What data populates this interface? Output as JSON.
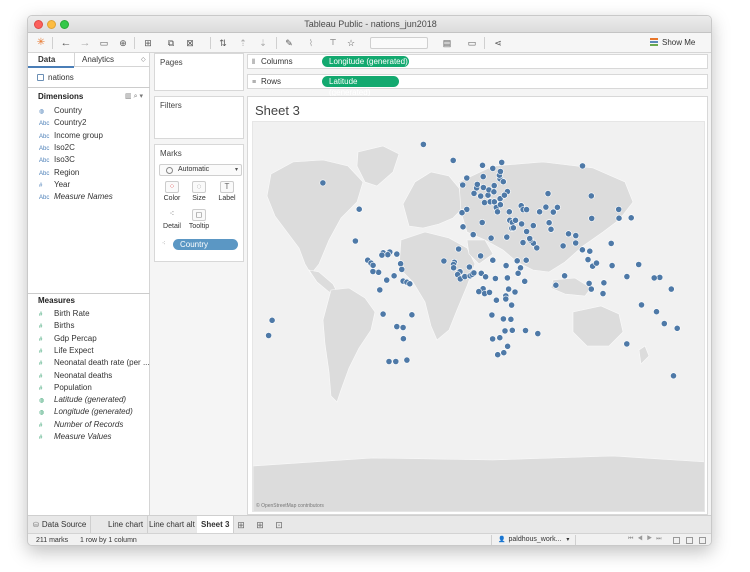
{
  "window": {
    "title": "Tableau Public - nations_jun2018"
  },
  "toolbar": {
    "show_me": "Show Me"
  },
  "data_pane": {
    "tabs": [
      "Data",
      "Analytics"
    ],
    "source": "nations",
    "dimensions_label": "Dimensions",
    "dimensions": [
      {
        "icon": "globe-icon",
        "label": "Country"
      },
      {
        "icon": "abc-icon",
        "label": "Country2"
      },
      {
        "icon": "abc-icon",
        "label": "Income group"
      },
      {
        "icon": "abc-icon",
        "label": "Iso2C"
      },
      {
        "icon": "abc-icon",
        "label": "Iso3C"
      },
      {
        "icon": "abc-icon",
        "label": "Region"
      },
      {
        "icon": "number-icon",
        "label": "Year"
      },
      {
        "icon": "abc-icon",
        "label": "Measure Names"
      }
    ],
    "measures_label": "Measures",
    "measures": [
      {
        "icon": "number-icon",
        "label": "Birth Rate"
      },
      {
        "icon": "number-icon",
        "label": "Births"
      },
      {
        "icon": "number-icon",
        "label": "Gdp Percap"
      },
      {
        "icon": "number-icon",
        "label": "Life Expect"
      },
      {
        "icon": "number-icon",
        "label": "Neonatal death rate (per ..."
      },
      {
        "icon": "number-icon",
        "label": "Neonatal deaths"
      },
      {
        "icon": "number-icon",
        "label": "Population"
      },
      {
        "icon": "globe-icon",
        "label": "Latitude (generated)"
      },
      {
        "icon": "globe-icon",
        "label": "Longitude (generated)"
      },
      {
        "icon": "number-icon",
        "label": "Number of Records"
      },
      {
        "icon": "number-icon",
        "label": "Measure Values"
      }
    ]
  },
  "cards": {
    "pages": "Pages",
    "filters": "Filters",
    "marks": "Marks",
    "mark_type": "Automatic",
    "mark_buttons": [
      "Color",
      "Size",
      "Label",
      "Detail",
      "Tooltip"
    ],
    "detail_pill": "Country"
  },
  "shelves": {
    "columns_label": "Columns",
    "columns_pill": "Longitude (generated)",
    "rows_label": "Rows",
    "rows_pill": "Latitude (generated)"
  },
  "view": {
    "sheet_title": "Sheet 3",
    "attribution": "© OpenStreetMap contributors",
    "mark_color": "#4e79a7",
    "points": [
      [
        -41.3,
        72.0
      ],
      [
        -128.2,
        53.2
      ],
      [
        -96.8,
        40.4
      ],
      [
        -100.1,
        24.9
      ],
      [
        -89.5,
        15.5
      ],
      [
        -86.6,
        14.1
      ],
      [
        -84.8,
        13.0
      ],
      [
        -80.1,
        9.6
      ],
      [
        -85.0,
        10.0
      ],
      [
        -76.1,
        19.1
      ],
      [
        -70.4,
        19.5
      ],
      [
        -64.3,
        18.5
      ],
      [
        -61.0,
        13.8
      ],
      [
        -60.0,
        11.0
      ],
      [
        -72.1,
        18.2
      ],
      [
        -77.2,
        18.0
      ],
      [
        -66.7,
        7.9
      ],
      [
        -73.1,
        5.8
      ],
      [
        -58.9,
        5.3
      ],
      [
        -55.6,
        4.8
      ],
      [
        -53.1,
        4.0
      ],
      [
        -79.0,
        1.0
      ],
      [
        -76.2,
        -10.8
      ],
      [
        -64.3,
        -16.9
      ],
      [
        -51.3,
        -11.1
      ],
      [
        -58.6,
        -22.8
      ],
      [
        -71.1,
        -33.9
      ],
      [
        -65.2,
        -33.9
      ],
      [
        -55.6,
        -33.2
      ],
      [
        -58.9,
        -17.3
      ],
      [
        -3.8,
        55.6
      ],
      [
        -7.4,
        52.2
      ],
      [
        -15.6,
        64.2
      ],
      [
        9.8,
        61.8
      ],
      [
        18.7,
        60.3
      ],
      [
        26.4,
        63.2
      ],
      [
        10.4,
        56.3
      ],
      [
        2.4,
        48.1
      ],
      [
        -3.8,
        40.3
      ],
      [
        -8.0,
        38.7
      ],
      [
        11.5,
        43.6
      ],
      [
        14.5,
        47.2
      ],
      [
        8.2,
        46.8
      ],
      [
        10.5,
        51.0
      ],
      [
        4.7,
        50.8
      ],
      [
        5.3,
        52.5
      ],
      [
        19.9,
        51.9
      ],
      [
        15.3,
        49.8
      ],
      [
        19.6,
        48.9
      ],
      [
        25.0,
        45.5
      ],
      [
        16.4,
        44.0
      ],
      [
        20.0,
        44.0
      ],
      [
        21.7,
        41.2
      ],
      [
        22.7,
        39.1
      ],
      [
        25.2,
        42.6
      ],
      [
        24.9,
        55.2
      ],
      [
        24.4,
        57.0
      ],
      [
        25.2,
        58.8
      ],
      [
        27.7,
        53.8
      ],
      [
        31.3,
        49.0
      ],
      [
        28.7,
        47.2
      ],
      [
        32.9,
        39.1
      ],
      [
        33.4,
        35.0
      ],
      [
        43.2,
        42.1
      ],
      [
        44.9,
        40.2
      ],
      [
        47.9,
        40.2
      ],
      [
        35.5,
        33.9
      ],
      [
        38.3,
        35.0
      ],
      [
        35.2,
        31.1
      ],
      [
        36.5,
        31.3
      ],
      [
        43.6,
        33.2
      ],
      [
        53.7,
        32.4
      ],
      [
        44.8,
        24.1
      ],
      [
        53.8,
        23.8
      ],
      [
        56.7,
        21.5
      ],
      [
        47.5,
        15.5
      ],
      [
        51.1,
        25.4
      ],
      [
        50.6,
        26.1
      ],
      [
        47.9,
        29.5
      ],
      [
        69.0,
        30.6
      ],
      [
        67.3,
        33.8
      ],
      [
        66.4,
        48.0
      ],
      [
        64.6,
        41.4
      ],
      [
        59.1,
        39.1
      ],
      [
        71.0,
        39.0
      ],
      [
        74.5,
        41.3
      ],
      [
        79.4,
        22.5
      ],
      [
        84.1,
        28.4
      ],
      [
        90.4,
        27.5
      ],
      [
        90.3,
        23.9
      ],
      [
        80.7,
        7.9
      ],
      [
        73.2,
        3.3
      ],
      [
        96.1,
        20.6
      ],
      [
        101.0,
        15.8
      ],
      [
        104.9,
        12.6
      ],
      [
        102.5,
        19.9
      ],
      [
        108.3,
        14.1
      ],
      [
        101.9,
        4.2
      ],
      [
        103.8,
        1.4
      ],
      [
        114.7,
        4.5
      ],
      [
        113.9,
        -0.8
      ],
      [
        121.8,
        12.9
      ],
      [
        121.0,
        23.7
      ],
      [
        104.2,
        35.9
      ],
      [
        103.8,
        46.9
      ],
      [
        127.8,
        36.0
      ],
      [
        127.5,
        40.3
      ],
      [
        138.3,
        36.2
      ],
      [
        96.2,
        61.5
      ],
      [
        1.7,
        28.0
      ],
      [
        9.5,
        33.9
      ],
      [
        17.2,
        26.3
      ],
      [
        30.8,
        26.8
      ],
      [
        -7.1,
        31.8
      ],
      [
        -10.9,
        21.0
      ],
      [
        -14.5,
        14.5
      ],
      [
        -15.3,
        13.4
      ],
      [
        -15.2,
        11.8
      ],
      [
        -9.7,
        9.9
      ],
      [
        -11.8,
        8.5
      ],
      [
        -9.4,
        6.4
      ],
      [
        -1.6,
        12.2
      ],
      [
        -5.5,
        7.5
      ],
      [
        -1.0,
        7.9
      ],
      [
        0.8,
        8.6
      ],
      [
        2.3,
        9.3
      ],
      [
        8.1,
        17.6
      ],
      [
        8.7,
        9.1
      ],
      [
        18.7,
        15.5
      ],
      [
        12.4,
        7.4
      ],
      [
        20.9,
        6.6
      ],
      [
        30.2,
        12.9
      ],
      [
        31.3,
        6.9
      ],
      [
        39.8,
        15.2
      ],
      [
        42.6,
        11.8
      ],
      [
        40.5,
        9.1
      ],
      [
        46.2,
        5.2
      ],
      [
        37.9,
        -0.0
      ],
      [
        32.3,
        1.4
      ],
      [
        29.9,
        -1.9
      ],
      [
        29.9,
        -3.4
      ],
      [
        34.9,
        -6.4
      ],
      [
        10.3,
        1.6
      ],
      [
        11.6,
        -0.8
      ],
      [
        15.8,
        -0.2
      ],
      [
        21.8,
        -4.0
      ],
      [
        17.9,
        -11.2
      ],
      [
        27.8,
        -13.1
      ],
      [
        34.3,
        -13.3
      ],
      [
        35.5,
        -18.7
      ],
      [
        29.2,
        -19.0
      ],
      [
        24.7,
        -22.3
      ],
      [
        18.5,
        -22.9
      ],
      [
        31.5,
        -26.5
      ],
      [
        28.2,
        -29.6
      ],
      [
        22.9,
        -30.6
      ],
      [
        46.9,
        -18.8
      ],
      [
        57.6,
        -20.3
      ],
      [
        -23.6,
        15.1
      ],
      [
        6.6,
        0.2
      ],
      [
        134.5,
        -25.3
      ],
      [
        147.2,
        -6.3
      ],
      [
        160.2,
        -9.6
      ],
      [
        166.9,
        -15.4
      ],
      [
        178.1,
        -17.7
      ],
      [
        -172.1,
        -13.8
      ],
      [
        -175.2,
        -21.2
      ],
      [
        173.0,
        1.4
      ],
      [
        163.0,
        7.1
      ],
      [
        144.8,
        13.4
      ],
      [
        134.6,
        7.5
      ],
      [
        174.9,
        -40.9
      ],
      [
        158.2,
        6.9
      ]
    ]
  }
}
